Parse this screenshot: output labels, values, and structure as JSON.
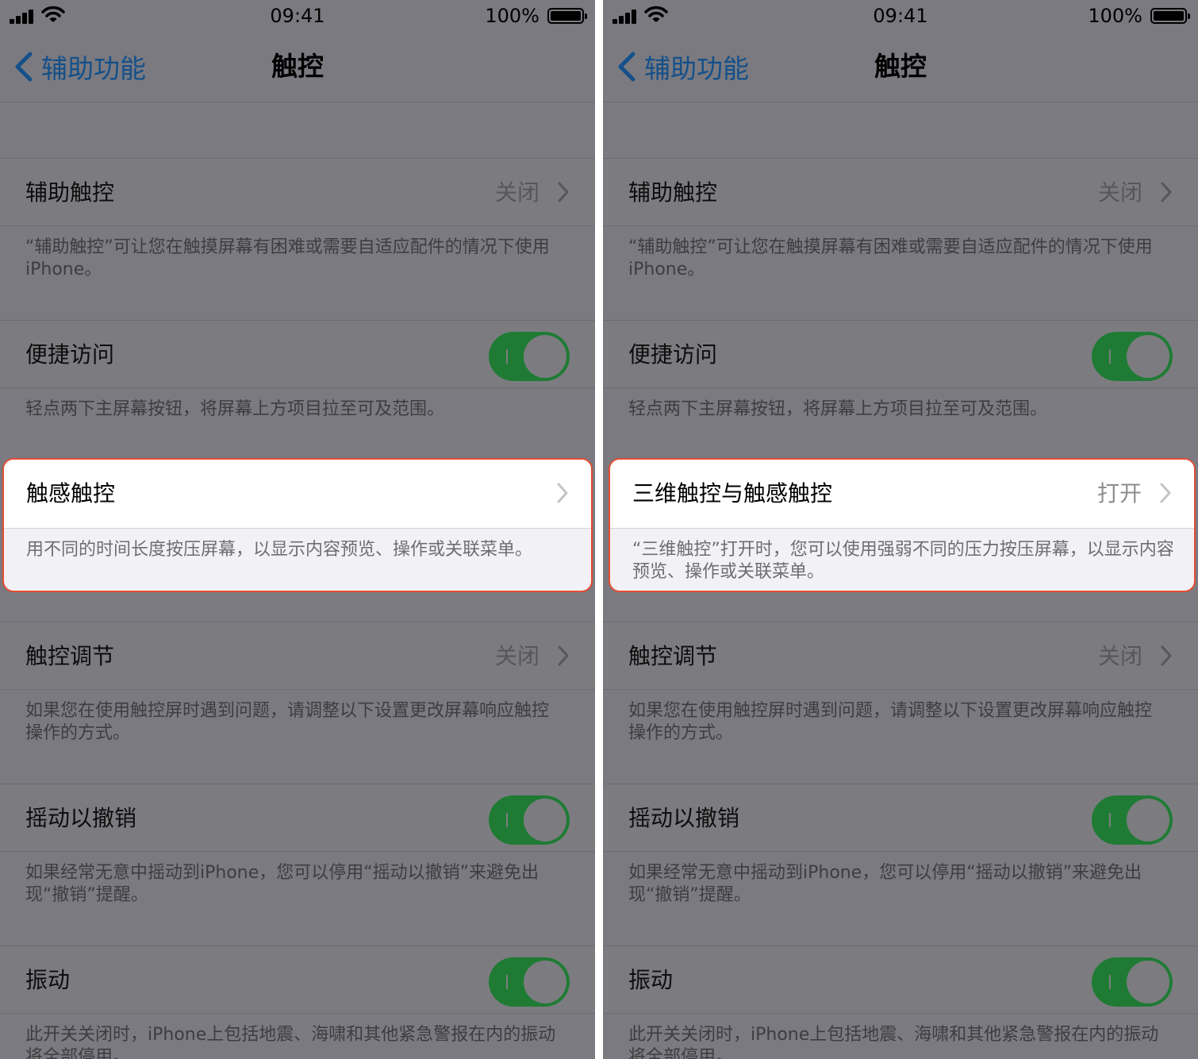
{
  "status": {
    "time": "09:41",
    "battery": "100%"
  },
  "nav": {
    "back_label": "辅助功能",
    "title": "触控"
  },
  "rows": {
    "assistive_touch": {
      "label": "辅助触控",
      "value": "关闭",
      "footer": "“辅助触控”可让您在触摸屏幕有困难或需要自适应配件的情况下使用iPhone。"
    },
    "reachability": {
      "label": "便捷访问",
      "footer": "轻点两下主屏幕按钮，将屏幕上方项目拉至可及范围。"
    },
    "touch_accommodations": {
      "label": "触控调节",
      "value": "关闭",
      "footer": "如果您在使用触控屏时遇到问题，请调整以下设置更改屏幕响应触控操作的方式。"
    },
    "shake_to_undo": {
      "label": "摇动以撤销",
      "footer": "如果经常无意中摇动到iPhone，您可以停用“摇动以撤销”来避免出现“撤销”提醒。"
    },
    "vibration": {
      "label": "振动",
      "footer": "此开关关闭时，iPhone上包括地震、海啸和其他紧急警报在内的振动将全部停用。"
    }
  },
  "left_highlight": {
    "label": "触感触控",
    "footer": "用不同的时间长度按压屏幕，以显示内容预览、操作或关联菜单。"
  },
  "right_highlight": {
    "label": "三维触控与触感触控",
    "value": "打开",
    "footer": "“三维触控”打开时，您可以使用强弱不同的压力按压屏幕，以显示内容预览、操作或关联菜单。"
  },
  "colors": {
    "accent": "#1f7b34",
    "highlight_border": "#e44d33",
    "link": "#14508a"
  }
}
